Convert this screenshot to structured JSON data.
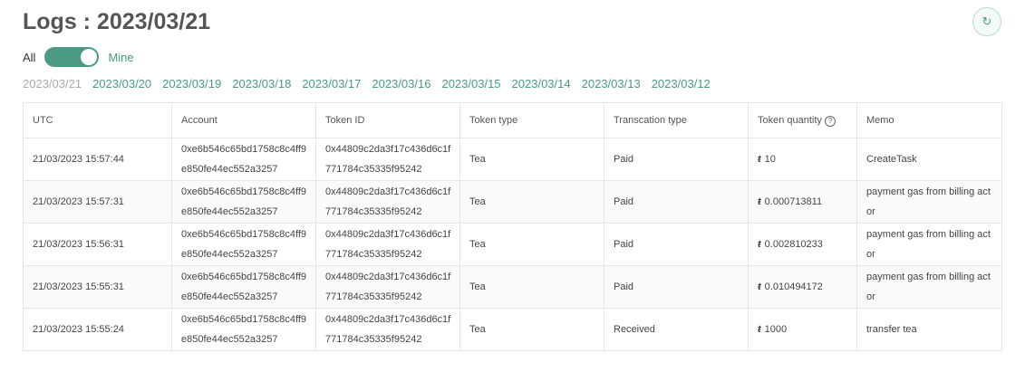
{
  "title": "Logs : 2023/03/21",
  "toggle": {
    "left": "All",
    "right": "Mine",
    "state": "Mine"
  },
  "dates": [
    "2023/03/21",
    "2023/03/20",
    "2023/03/19",
    "2023/03/18",
    "2023/03/17",
    "2023/03/16",
    "2023/03/15",
    "2023/03/14",
    "2023/03/13",
    "2023/03/12"
  ],
  "columns": [
    "UTC",
    "Account",
    "Token ID",
    "Token type",
    "Transcation type",
    "Token quantity",
    "Memo"
  ],
  "token_symbol": "ŧ",
  "rows": [
    {
      "utc": "21/03/2023 15:57:44",
      "account1": "0xe6b546c65bd1758c8c4ff9",
      "account2": "e850fe44ec552a3257",
      "token1": "0x44809c2da3f17c436d6c1f",
      "token2": "771784c35335f95242",
      "type": "Tea",
      "tx": "Paid",
      "qty": "10",
      "memo": "CreateTask"
    },
    {
      "utc": "21/03/2023 15:57:31",
      "account1": "0xe6b546c65bd1758c8c4ff9",
      "account2": "e850fe44ec552a3257",
      "token1": "0x44809c2da3f17c436d6c1f",
      "token2": "771784c35335f95242",
      "type": "Tea",
      "tx": "Paid",
      "qty": "0.000713811",
      "memo": "payment gas from billing actor"
    },
    {
      "utc": "21/03/2023 15:56:31",
      "account1": "0xe6b546c65bd1758c8c4ff9",
      "account2": "e850fe44ec552a3257",
      "token1": "0x44809c2da3f17c436d6c1f",
      "token2": "771784c35335f95242",
      "type": "Tea",
      "tx": "Paid",
      "qty": "0.002810233",
      "memo": "payment gas from billing actor"
    },
    {
      "utc": "21/03/2023 15:55:31",
      "account1": "0xe6b546c65bd1758c8c4ff9",
      "account2": "e850fe44ec552a3257",
      "token1": "0x44809c2da3f17c436d6c1f",
      "token2": "771784c35335f95242",
      "type": "Tea",
      "tx": "Paid",
      "qty": "0.010494172",
      "memo": "payment gas from billing actor"
    },
    {
      "utc": "21/03/2023 15:55:24",
      "account1": "0xe6b546c65bd1758c8c4ff9",
      "account2": "e850fe44ec552a3257",
      "token1": "0x44809c2da3f17c436d6c1f",
      "token2": "771784c35335f95242",
      "type": "Tea",
      "tx": "Received",
      "qty": "1000",
      "memo": "transfer tea"
    }
  ]
}
